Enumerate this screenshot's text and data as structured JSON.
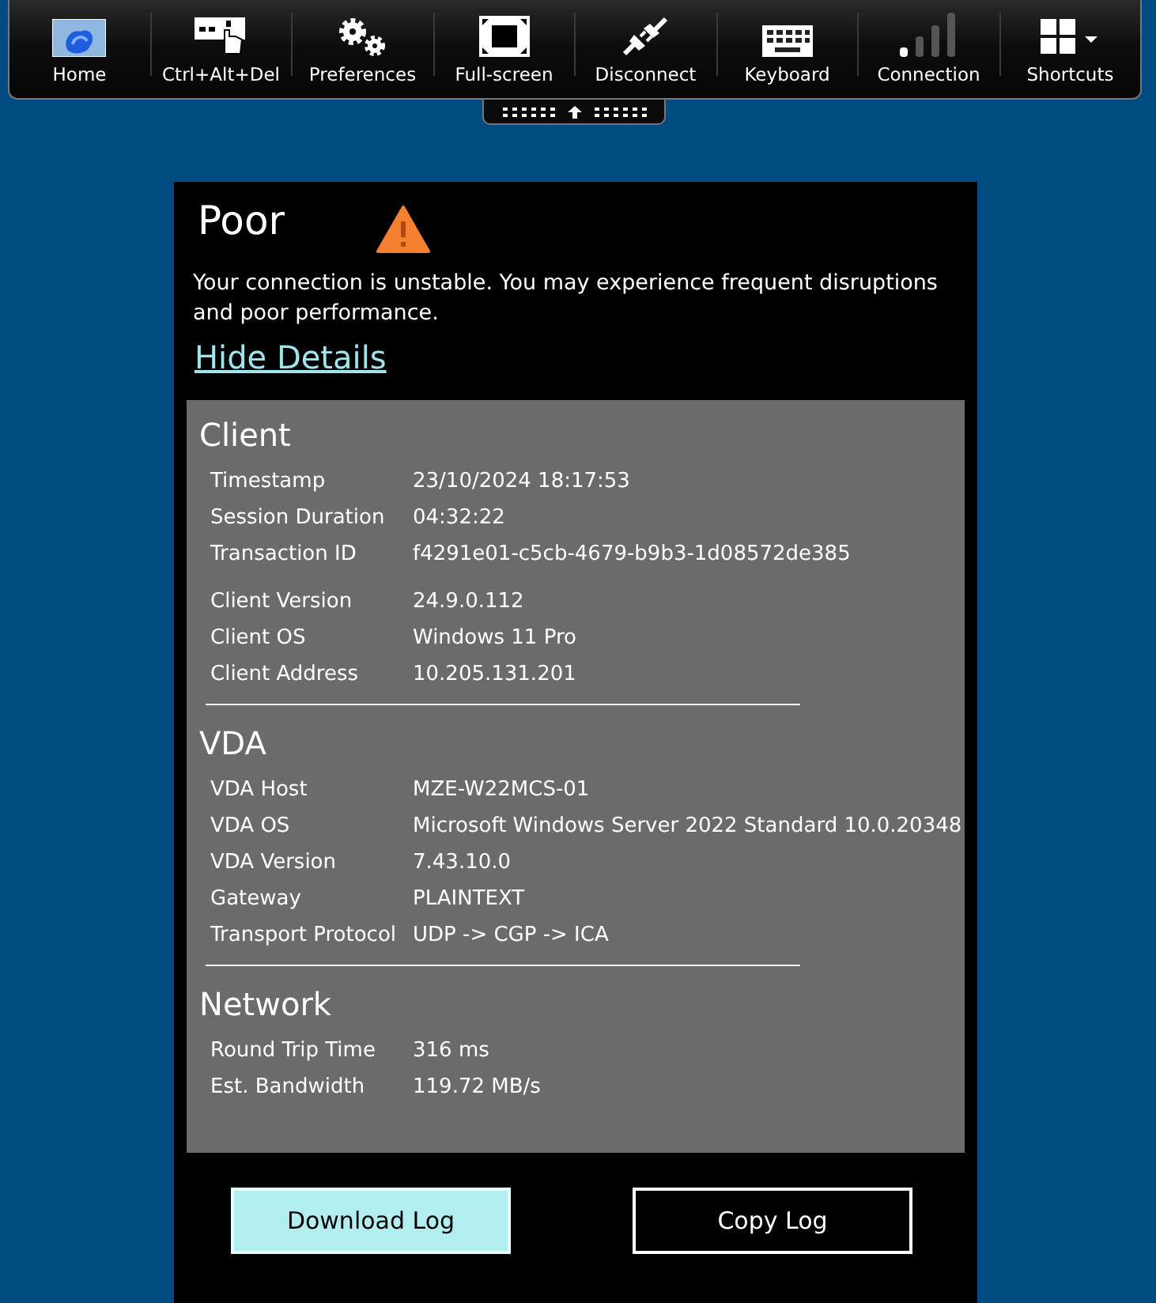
{
  "toolbar": {
    "items": [
      {
        "kind": "home",
        "label": "Home"
      },
      {
        "kind": "ctrl-alt-del",
        "label": "Ctrl+Alt+Del"
      },
      {
        "kind": "preferences",
        "label": "Preferences"
      },
      {
        "kind": "fullscreen",
        "label": "Full-screen"
      },
      {
        "kind": "disconnect",
        "label": "Disconnect"
      },
      {
        "kind": "keyboard",
        "label": "Keyboard"
      },
      {
        "kind": "connection",
        "label": "Connection"
      },
      {
        "kind": "shortcuts",
        "label": "Shortcuts"
      }
    ]
  },
  "status": {
    "title": "Poor",
    "message": "Your connection is unstable. You may experience frequent disruptions and poor performance.",
    "details_link": "Hide Details"
  },
  "details": {
    "sections": [
      {
        "heading": "Client",
        "groups": [
          [
            {
              "label": "Timestamp",
              "value": "23/10/2024 18:17:53"
            },
            {
              "label": "Session Duration",
              "value": "04:32:22"
            },
            {
              "label": "Transaction ID",
              "value": "f4291e01-c5cb-4679-b9b3-1d08572de385"
            }
          ],
          [
            {
              "label": "Client Version",
              "value": "24.9.0.112"
            },
            {
              "label": "Client OS",
              "value": "Windows 11 Pro"
            },
            {
              "label": "Client Address",
              "value": "10.205.131.201"
            }
          ]
        ]
      },
      {
        "heading": "VDA",
        "groups": [
          [
            {
              "label": "VDA Host",
              "value": "MZE-W22MCS-01"
            },
            {
              "label": "VDA OS",
              "value": "Microsoft Windows Server 2022 Standard 10.0.20348"
            },
            {
              "label": "VDA Version",
              "value": "7.43.10.0"
            },
            {
              "label": "Gateway",
              "value": "PLAINTEXT"
            },
            {
              "label": "Transport Protocol",
              "value": "UDP -> CGP -> ICA"
            }
          ]
        ]
      },
      {
        "heading": "Network",
        "groups": [
          [
            {
              "label": "Round Trip Time",
              "value": "316 ms"
            },
            {
              "label": "Est. Bandwidth",
              "value": "119.72 MB/s"
            }
          ]
        ]
      }
    ]
  },
  "buttons": [
    {
      "kind": "primary",
      "label": "Download Log"
    },
    {
      "kind": "secondary",
      "label": "Copy Log"
    }
  ]
}
